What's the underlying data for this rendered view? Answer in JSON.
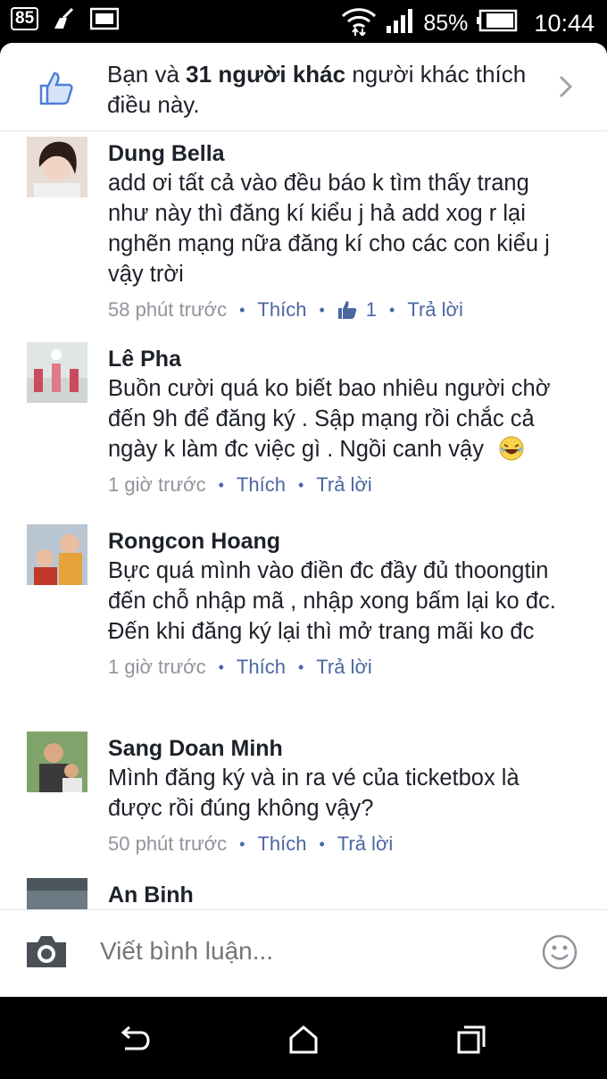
{
  "status_bar": {
    "notification_badge": "85",
    "battery_percent": "85%",
    "time": "10:44"
  },
  "likes": {
    "prefix": "Bạn và ",
    "bold": "31 người khác",
    "suffix": " người khác thích điều này."
  },
  "comments": [
    {
      "name": "Dung Bella",
      "text": "add ơi tất cả vào đều báo k tìm thấy trang như này thì đăng kí kiểu j hả add xog r lại nghẽn mạng nữa đăng kí cho các con kiểu j vậy trời",
      "time": "58 phút trước",
      "like_label": "Thích",
      "like_count": "1",
      "reply_label": "Trả lời"
    },
    {
      "name": "Lê Pha",
      "text": "Buồn cười quá ko biết bao nhiêu người chờ đến 9h để đăng ký . Sập mạng rồi chắc cả ngày k làm đc việc gì . Ngồi canh vậy",
      "time": "1 giờ trước",
      "like_label": "Thích",
      "reply_label": "Trả lời"
    },
    {
      "name": "Rongcon Hoang",
      "text": "Bực quá mình vào điền đc đầy đủ thoongtin đến chỗ nhập mã , nhập xong bấm lại ko đc. Đến khi đăng ký lại thì mở trang mãi ko đc",
      "time": "1 giờ trước",
      "like_label": "Thích",
      "reply_label": "Trả lời"
    },
    {
      "name": "Sang Doan Minh",
      "text": "Mình đăng ký và in ra vé của ticketbox là được rồi đúng không vậy?",
      "time": "50 phút trước",
      "like_label": "Thích",
      "reply_label": "Trả lời"
    },
    {
      "name": "An Binh"
    }
  ],
  "composer": {
    "placeholder": "Viết bình luận..."
  },
  "icons": {
    "like": "thumbs-up-icon",
    "chevron": "chevron-right-icon",
    "camera": "camera-icon",
    "emoji": "smiley-icon",
    "back": "back-icon",
    "home": "home-icon",
    "recents": "recents-icon"
  },
  "colors": {
    "link": "#4b67a1",
    "meta": "#90949c",
    "text": "#1d2129"
  }
}
